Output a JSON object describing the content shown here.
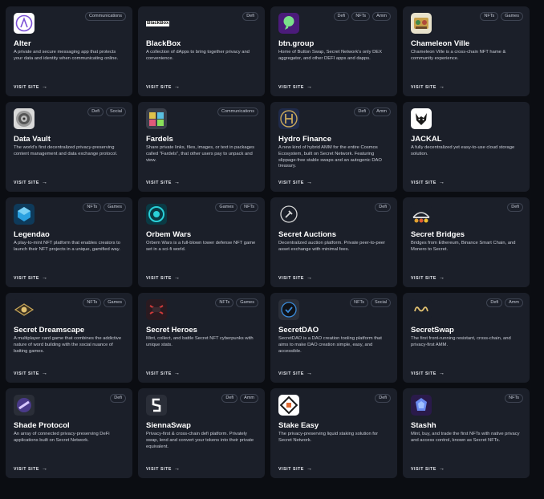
{
  "visit_label": "VISIT SITE",
  "arrow_glyph": "→",
  "cards": [
    {
      "name": "Alter",
      "icon": "alter-logo-icon",
      "tags": [
        "Communications"
      ],
      "description": "A private and secure messaging app that protects your data and identity when communicating online."
    },
    {
      "name": "BlackBox",
      "icon": "blackbox-logo-icon",
      "logo_text": "BlackBox",
      "tags": [
        "Defi"
      ],
      "description": "A collection of dApps to bring together privacy and convenience."
    },
    {
      "name": "btn.group",
      "icon": "btn-group-logo-icon",
      "tags": [
        "Defi",
        "NFTs",
        "Amm"
      ],
      "description": "Home of Button Swap, Secret Network's only DEX aggregator, and other DEFI apps and dapps."
    },
    {
      "name": "Chameleon Ville",
      "icon": "chameleon-ville-logo-icon",
      "tags": [
        "NFTs",
        "Games"
      ],
      "description": "Chameleon Ville is a cross-chain NFT hame & community experience."
    },
    {
      "name": "Data Vault",
      "icon": "data-vault-logo-icon",
      "tags": [
        "Defi",
        "Social"
      ],
      "description": "The world's first decentralized privacy-preserving content management and data exchange protocol."
    },
    {
      "name": "Fardels",
      "icon": "fardels-logo-icon",
      "tags": [
        "Communications"
      ],
      "description": "Share private links, files, images, or text in packages called \"Fardels\", that other users pay to unpack and view."
    },
    {
      "name": "Hydro Finance",
      "icon": "hydro-finance-logo-icon",
      "tags": [
        "Defi",
        "Amm"
      ],
      "description": "A new kind of hybrid AMM for the entire Cosmos Ecosystem, built on Secret Network. Featuring slippage-free stable swaps and an autogenic DAO treasury."
    },
    {
      "name": "JACKAL",
      "icon": "jackal-logo-icon",
      "tags": [],
      "description": "A fully decentralized yet easy-to-use cloud storage solution."
    },
    {
      "name": "Legendao",
      "icon": "legendao-logo-icon",
      "tags": [
        "NFTs",
        "Games"
      ],
      "description": "A play-to-mint NFT platform that enables creators to launch their NFT projects in a unique, gamified way."
    },
    {
      "name": "Orbem Wars",
      "icon": "orbem-wars-logo-icon",
      "tags": [
        "Games",
        "NFTs"
      ],
      "description": "Orbem Wars is a full-blown tower defense NFT game set in a sci-fi world."
    },
    {
      "name": "Secret Auctions",
      "icon": "secret-auctions-logo-icon",
      "tags": [
        "Defi"
      ],
      "description": "Decentralized auction platform. Private peer-to-peer asset exchange with minimal fees."
    },
    {
      "name": "Secret Bridges",
      "icon": "secret-bridges-logo-icon",
      "tags": [
        "Defi"
      ],
      "description": "Bridges from Ethereum, Binance Smart Chain, and Monero to Secret."
    },
    {
      "name": "Secret Dreamscape",
      "icon": "secret-dreamscape-logo-icon",
      "tags": [
        "NFTs",
        "Games"
      ],
      "description": "A multiplayer card game that combines the addictive nature of word building with the social nuance of batting games."
    },
    {
      "name": "Secret Heroes",
      "icon": "secret-heroes-logo-icon",
      "tags": [
        "NFTs",
        "Games"
      ],
      "description": "Mint, collect, and battle Secret NFT cyberpunks with unique stats."
    },
    {
      "name": "SecretDAO",
      "icon": "secretdao-logo-icon",
      "tags": [
        "NFTs",
        "Social"
      ],
      "description": "SecretDAO is a DAO creation tooling platform that aims to make DAO creation simple, easy, and accessible."
    },
    {
      "name": "SecretSwap",
      "icon": "secretswap-logo-icon",
      "tags": [
        "Defi",
        "Amm"
      ],
      "description": "The first front-running resistant, cross-chain, and privacy-first AMM."
    },
    {
      "name": "Shade Protocol",
      "icon": "shade-protocol-logo-icon",
      "tags": [
        "Defi"
      ],
      "description": "An array of connected privacy-preserving DeFi applications built on Secret Network."
    },
    {
      "name": "SiennaSwap",
      "icon": "siennaswap-logo-icon",
      "tags": [
        "Defi",
        "Amm"
      ],
      "description": "Privacy-first & cross-chain defi platform. Privately swap, lend and convert your tokens into their private equivalent."
    },
    {
      "name": "Stake Easy",
      "icon": "stake-easy-logo-icon",
      "tags": [
        "Defi"
      ],
      "description": "The privacy-preserving liquid staking solution for Secret Network."
    },
    {
      "name": "Stashh",
      "icon": "stashh-logo-icon",
      "tags": [
        "NFTs"
      ],
      "description": "Mint, buy, and trade the first NFTs with native privacy and access control, known as Secret NFTs."
    }
  ]
}
